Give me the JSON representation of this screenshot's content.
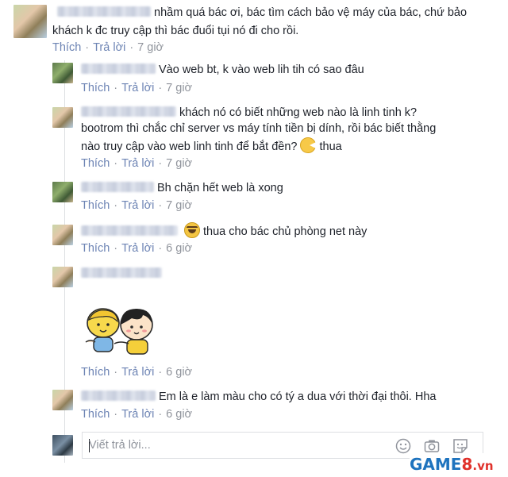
{
  "main_comment": {
    "text_line1": "nhầm quá bác ơi, bác tìm cách bảo vệ máy của bác, chứ bảo",
    "text_line2": "khách k đc truy cập thì bác đuổi tụi nó đi cho rồi.",
    "like_label": "Thích",
    "reply_label": "Trả lời",
    "time": "7 giờ"
  },
  "replies": [
    {
      "lines": [
        "Vào web bt, k vào web lih tih có sao đâu"
      ],
      "like_label": "Thích",
      "reply_label": "Trả lời",
      "time": "7 giờ"
    },
    {
      "lines": [
        "khách nó có biết những web nào là linh tinh k?",
        "bootrom thì chắc chỉ server vs máy tính tiền bị dính, rồi bác biết thằng",
        "nào truy cập vào web linh tinh để bắt đền?"
      ],
      "trailing": "thua",
      "like_label": "Thích",
      "reply_label": "Trả lời",
      "time": "7 giờ"
    },
    {
      "lines": [
        "Bh chặn hết web là xong"
      ],
      "like_label": "Thích",
      "reply_label": "Trả lời",
      "time": "7 giờ"
    },
    {
      "lines": [
        "thua cho bác chủ phòng net này"
      ],
      "like_label": "Thích",
      "reply_label": "Trả lời",
      "time": "6 giờ"
    },
    {
      "lines": [],
      "like_label": "Thích",
      "reply_label": "Trả lời",
      "time": "6 giờ"
    },
    {
      "lines": [
        "Em là e làm màu cho có tý a dua với thời đại thôi. Hha"
      ],
      "like_label": "Thích",
      "reply_label": "Trả lời",
      "time": "6 giờ"
    }
  ],
  "reply_input": {
    "placeholder": "Viết trả lời..."
  },
  "icons": {
    "emoji": "smiley-icon",
    "camera": "camera-icon",
    "sticker": "sticker-icon"
  },
  "watermark": {
    "game": "GAME",
    "eight": "8",
    "domain": ".vn"
  },
  "colors": {
    "link": "#6d84b4",
    "meta": "#90949c",
    "text": "#1d2129",
    "brand": "#1e73be",
    "brand_red": "#e0312b"
  }
}
